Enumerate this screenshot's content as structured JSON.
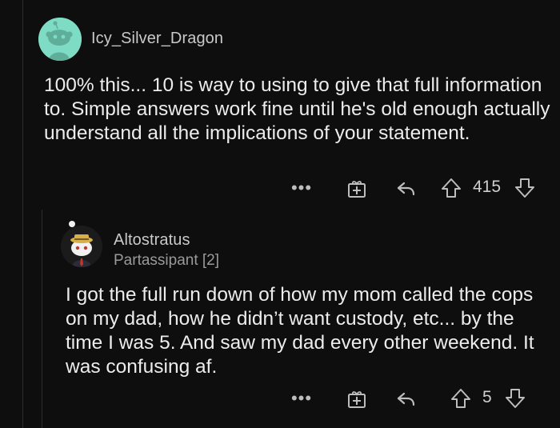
{
  "comments": [
    {
      "username": "Icy_Silver_Dragon",
      "body": "100% this... 10 is way to using to give that full information to. Simple answers work fine until he's old enough actually understand all the implications of your statement.",
      "score": "415",
      "more_label": "•••"
    },
    {
      "username": "Altostratus",
      "flair": "Partassipant [2]",
      "body": "I got the full run down of how my mom called the cops on my dad, how he didn’t want custody, etc... by the time I was 5. And saw my dad every other weekend. It was confusing af.",
      "score": "5",
      "more_label": "•••"
    }
  ],
  "icons": [
    "reddit-snoo-avatar",
    "custom-snoo-avatar",
    "more-icon",
    "award-icon",
    "reply-icon",
    "upvote-icon",
    "downvote-icon"
  ],
  "colors": {
    "background": "#0e0e0e",
    "avatar_bg": "#7fdcc4",
    "text": "#ececec",
    "muted": "#9a9a9a"
  }
}
